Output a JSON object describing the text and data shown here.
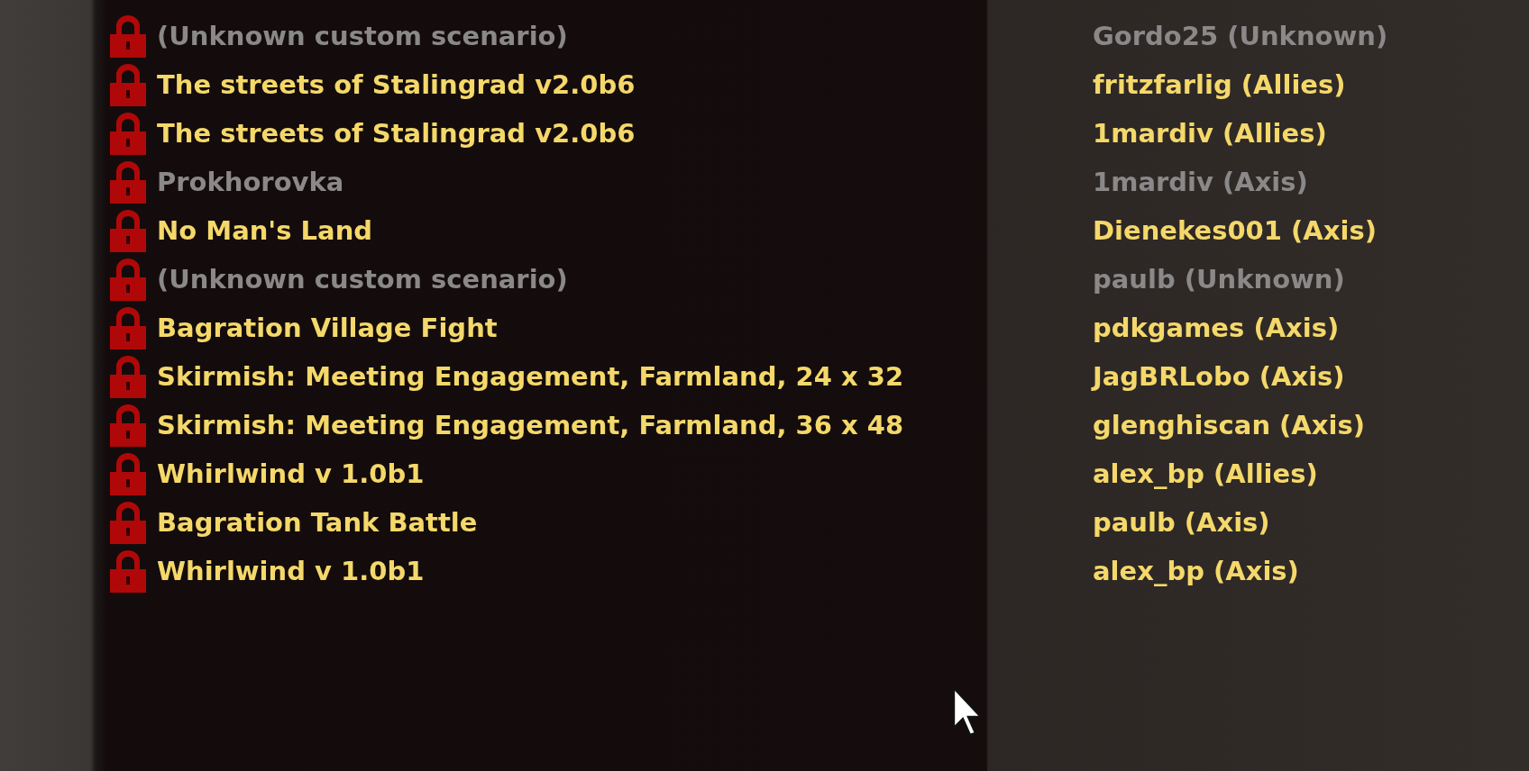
{
  "games": [
    {
      "scenario": "(Unknown custom scenario)",
      "host": "Gordo25 (Unknown)",
      "available": false,
      "locked": true
    },
    {
      "scenario": "The streets of Stalingrad v2.0b6",
      "host": "fritzfarlig (Allies)",
      "available": true,
      "locked": true
    },
    {
      "scenario": "The streets of Stalingrad v2.0b6",
      "host": "1mardiv (Allies)",
      "available": true,
      "locked": true
    },
    {
      "scenario": "Prokhorovka",
      "host": "1mardiv (Axis)",
      "available": false,
      "locked": true
    },
    {
      "scenario": "No Man's Land",
      "host": "Dienekes001 (Axis)",
      "available": true,
      "locked": true
    },
    {
      "scenario": "(Unknown custom scenario)",
      "host": "paulb (Unknown)",
      "available": false,
      "locked": true
    },
    {
      "scenario": "Bagration Village Fight",
      "host": "pdkgames (Axis)",
      "available": true,
      "locked": true
    },
    {
      "scenario": "Skirmish: Meeting Engagement, Farmland, 24 x 32",
      "host": "JagBRLobo (Axis)",
      "available": true,
      "locked": true
    },
    {
      "scenario": "Skirmish: Meeting Engagement, Farmland, 36 x 48",
      "host": "glenghiscan (Axis)",
      "available": true,
      "locked": true
    },
    {
      "scenario": "Whirlwind v 1.0b1",
      "host": "alex_bp (Allies)",
      "available": true,
      "locked": true
    },
    {
      "scenario": "Bagration Tank Battle",
      "host": "paulb (Axis)",
      "available": true,
      "locked": true
    },
    {
      "scenario": "Whirlwind v 1.0b1",
      "host": "alex_bp (Axis)",
      "available": true,
      "locked": true
    }
  ]
}
